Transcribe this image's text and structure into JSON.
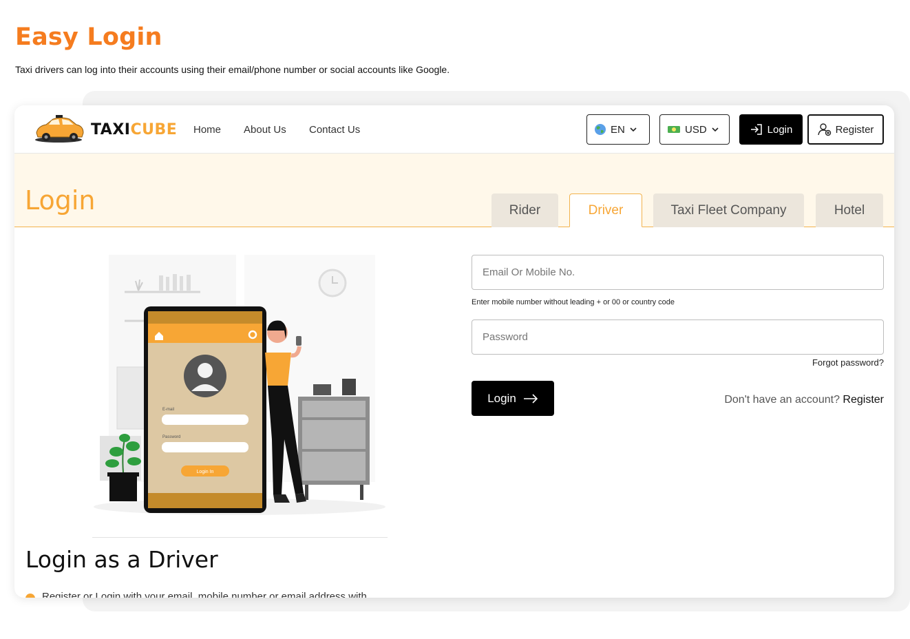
{
  "page": {
    "heading": "Easy Login",
    "subheading": "Taxi drivers can log into their accounts using their email/phone number or social accounts like Google."
  },
  "header": {
    "brand_part1": "TAXI",
    "brand_part2": "CUBE",
    "nav": [
      "Home",
      "About Us",
      "Contact Us"
    ],
    "language": "EN",
    "currency": "USD",
    "login_label": "Login",
    "register_label": "Register"
  },
  "banner": {
    "title": "Login",
    "tabs": [
      {
        "label": "Rider",
        "active": false
      },
      {
        "label": "Driver",
        "active": true
      },
      {
        "label": "Taxi Fleet Company",
        "active": false
      },
      {
        "label": "Hotel",
        "active": false
      }
    ]
  },
  "illustration": {
    "email_label": "E-mail",
    "password_label": "Password",
    "login_label": "Login In"
  },
  "form": {
    "email_placeholder": "Email Or Mobile No.",
    "hint": "Enter mobile number without leading + or 00 or country code",
    "password_placeholder": "Password",
    "forgot": "Forgot password?",
    "login_label": "Login",
    "no_account": "Don't have an account?",
    "register_link": "Register"
  },
  "section": {
    "title": "Login as a Driver",
    "bullet": "Register or Login with your email, mobile number or email address with"
  },
  "colors": {
    "accent": "#f7a635",
    "heading": "#f57c1f",
    "banner_bg": "#fff8ea"
  }
}
